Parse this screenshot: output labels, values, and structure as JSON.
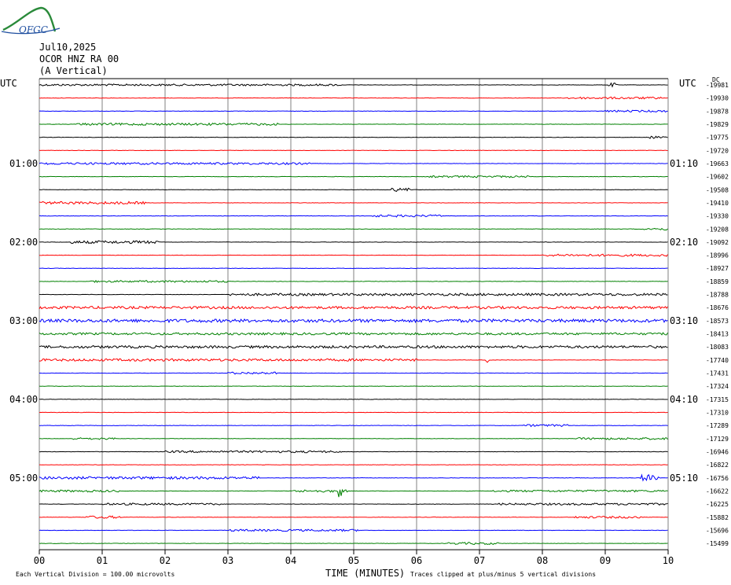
{
  "header": {
    "logo_text": "OFGC",
    "date": "Jul10,2025",
    "station": "OCOR HNZ RA 00",
    "component": "(A Vertical)"
  },
  "chart_data": {
    "type": "line",
    "chart_kind": "helicorder",
    "xlabel": "TIME (MINUTES)",
    "x_ticks": [
      "00",
      "01",
      "02",
      "03",
      "04",
      "05",
      "06",
      "07",
      "08",
      "09",
      "10"
    ],
    "xlim": [
      0,
      10
    ],
    "grid": true,
    "row_minutes": 10,
    "trace_colors": [
      "#000000",
      "#ff0000",
      "#0000ff",
      "#008000"
    ],
    "left_axis_title": "UTC",
    "right_axis_title": "UTC",
    "dc_label": "DC",
    "left_time_labels": [
      {
        "row": 6,
        "label": "01:00"
      },
      {
        "row": 12,
        "label": "02:00"
      },
      {
        "row": 18,
        "label": "03:00"
      },
      {
        "row": 24,
        "label": "04:00"
      },
      {
        "row": 30,
        "label": "05:00"
      }
    ],
    "right_time_labels": [
      {
        "row": 6,
        "label": "01:10"
      },
      {
        "row": 12,
        "label": "02:10"
      },
      {
        "row": 18,
        "label": "03:10"
      },
      {
        "row": 24,
        "label": "04:10"
      },
      {
        "row": 30,
        "label": "05:10"
      }
    ],
    "dc_offsets": [
      "-19981",
      "-19930",
      "-19878",
      "-19829",
      "-19775",
      "-19720",
      "-19663",
      "-19602",
      "-19508",
      "-19410",
      "-19330",
      "-19208",
      "-19092",
      "-18996",
      "-18927",
      "-18859",
      "-18788",
      "-18676",
      "-18573",
      "-18413",
      "-18083",
      "-17740",
      "-17431",
      "-17324",
      "-17315",
      "-17310",
      "-17289",
      "-17129",
      "-16946",
      "-16822",
      "-16756",
      "-16622",
      "-16225",
      "-15882",
      "-15696",
      "-15499"
    ],
    "bursts": [
      {
        "row": 0,
        "start": 0.0,
        "end": 4.8,
        "amp": 1.2
      },
      {
        "row": 0,
        "start": 9.05,
        "end": 9.2,
        "amp": 2.5
      },
      {
        "row": 1,
        "start": 8.4,
        "end": 9.9,
        "amp": 1.3
      },
      {
        "row": 2,
        "start": 9.0,
        "end": 10.0,
        "amp": 1.2
      },
      {
        "row": 3,
        "start": 0.6,
        "end": 3.8,
        "amp": 1.4
      },
      {
        "row": 4,
        "start": 9.7,
        "end": 10.0,
        "amp": 1.5
      },
      {
        "row": 6,
        "start": 0.0,
        "end": 4.3,
        "amp": 1.3
      },
      {
        "row": 7,
        "start": 6.2,
        "end": 7.8,
        "amp": 1.2
      },
      {
        "row": 8,
        "start": 5.6,
        "end": 5.9,
        "amp": 2.2
      },
      {
        "row": 9,
        "start": 0.0,
        "end": 1.7,
        "amp": 1.6
      },
      {
        "row": 10,
        "start": 5.3,
        "end": 6.4,
        "amp": 1.4
      },
      {
        "row": 11,
        "start": 9.6,
        "end": 10.0,
        "amp": 1.6
      },
      {
        "row": 12,
        "start": 0.5,
        "end": 1.9,
        "amp": 1.8
      },
      {
        "row": 13,
        "start": 8.0,
        "end": 10.0,
        "amp": 1.4
      },
      {
        "row": 15,
        "start": 0.8,
        "end": 3.0,
        "amp": 1.2
      },
      {
        "row": 16,
        "start": 3.0,
        "end": 10.0,
        "amp": 1.5
      },
      {
        "row": 17,
        "start": 0.0,
        "end": 10.0,
        "amp": 1.6
      },
      {
        "row": 18,
        "start": 0.0,
        "end": 10.0,
        "amp": 2.0
      },
      {
        "row": 19,
        "start": 0.0,
        "end": 10.0,
        "amp": 1.4
      },
      {
        "row": 20,
        "start": 0.0,
        "end": 10.0,
        "amp": 1.6
      },
      {
        "row": 21,
        "start": 0.0,
        "end": 6.0,
        "amp": 1.5
      },
      {
        "row": 21,
        "start": 7.1,
        "end": 7.15,
        "amp": 3.0
      },
      {
        "row": 22,
        "start": 3.0,
        "end": 3.8,
        "amp": 1.4
      },
      {
        "row": 26,
        "start": 7.7,
        "end": 8.4,
        "amp": 1.4
      },
      {
        "row": 27,
        "start": 0.5,
        "end": 1.2,
        "amp": 1.2
      },
      {
        "row": 27,
        "start": 8.5,
        "end": 10.0,
        "amp": 1.3
      },
      {
        "row": 28,
        "start": 2.0,
        "end": 4.8,
        "amp": 1.3
      },
      {
        "row": 30,
        "start": 0.0,
        "end": 3.5,
        "amp": 1.6
      },
      {
        "row": 30,
        "start": 9.55,
        "end": 9.85,
        "amp": 4.0
      },
      {
        "row": 31,
        "start": 0.0,
        "end": 1.3,
        "amp": 1.3
      },
      {
        "row": 31,
        "start": 4.0,
        "end": 4.9,
        "amp": 1.5
      },
      {
        "row": 31,
        "start": 4.75,
        "end": 4.8,
        "amp": 8.0
      },
      {
        "row": 31,
        "start": 7.2,
        "end": 10.0,
        "amp": 1.2
      },
      {
        "row": 32,
        "start": 1.0,
        "end": 2.9,
        "amp": 1.2
      },
      {
        "row": 32,
        "start": 7.3,
        "end": 10.0,
        "amp": 1.2
      },
      {
        "row": 33,
        "start": 0.7,
        "end": 1.3,
        "amp": 1.6
      },
      {
        "row": 33,
        "start": 8.5,
        "end": 9.6,
        "amp": 1.3
      },
      {
        "row": 34,
        "start": 3.0,
        "end": 5.1,
        "amp": 1.3
      },
      {
        "row": 35,
        "start": 6.5,
        "end": 7.3,
        "amp": 1.4
      }
    ]
  },
  "footer": {
    "vertical_division": "Each Vertical Division =  100.00 microvolts",
    "clip_note": "Traces clipped at plus/minus 5 vertical divisions"
  }
}
